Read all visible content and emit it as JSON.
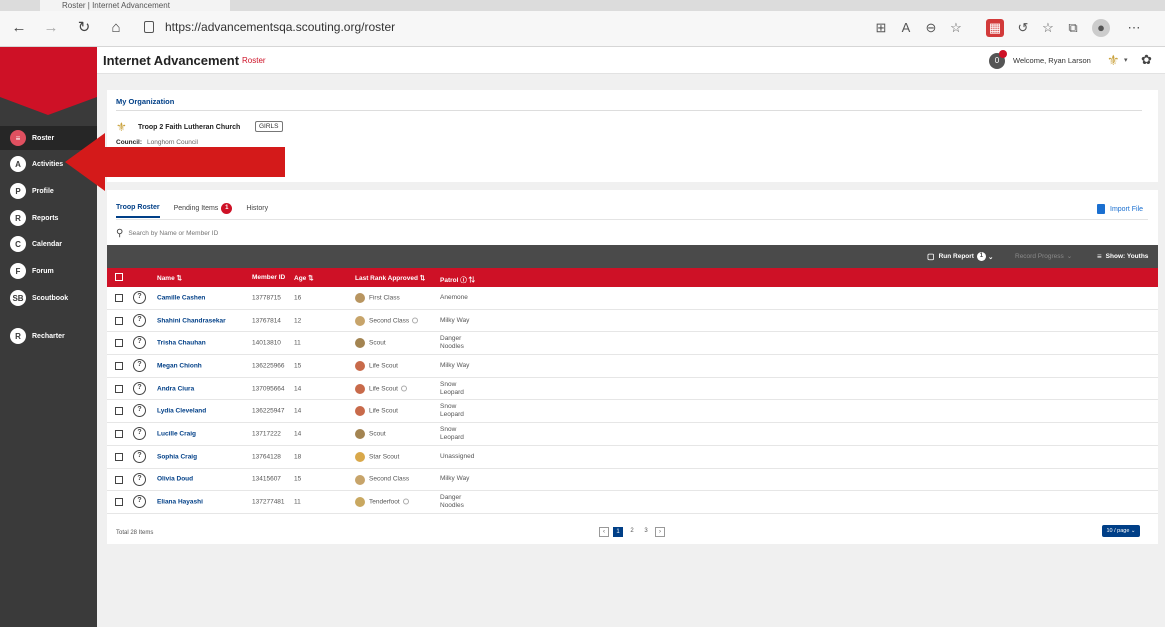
{
  "browser": {
    "tab_title": "Roster | Internet Advancement",
    "url": "https://advancementsqa.scouting.org/roster"
  },
  "sidebar": {
    "items": [
      {
        "label": "Roster",
        "icon": "roster-icon",
        "glyph": "≡",
        "active": true
      },
      {
        "label": "Activities",
        "icon": "activities-icon",
        "glyph": "A"
      },
      {
        "label": "Profile",
        "icon": "profile-icon",
        "glyph": "P"
      },
      {
        "label": "Reports",
        "icon": "reports-icon",
        "glyph": "R"
      },
      {
        "label": "Calendar",
        "icon": "calendar-icon",
        "glyph": "C"
      },
      {
        "label": "Forum",
        "icon": "forum-icon",
        "glyph": "F"
      },
      {
        "label": "Scoutbook",
        "icon": "scoutbook-icon",
        "glyph": "SB"
      },
      {
        "label": "Recharter",
        "icon": "recharter-icon",
        "glyph": "R"
      }
    ]
  },
  "header": {
    "title": "Internet Advancement",
    "subtitle": "Roster",
    "notification_count": "0",
    "welcome": "Welcome, Ryan Larson"
  },
  "organization": {
    "heading": "My Organization",
    "unit_name": "Troop 2 Faith Lutheran Church",
    "unit_tag": "GIRLS",
    "council_label": "Council:",
    "council_value": "Longhorn Council"
  },
  "roster": {
    "tabs": [
      {
        "label": "Troop Roster",
        "active": true
      },
      {
        "label": "Pending Items",
        "count": "1"
      },
      {
        "label": "History"
      }
    ],
    "import_label": "Import File",
    "search_placeholder": "Search by Name or Member ID",
    "actions": {
      "run_report": "Run Report",
      "run_report_badge": "1",
      "record_progress": "Record Progress",
      "show_filter": "Show: Youths"
    },
    "columns": {
      "name": "Name",
      "member_id": "Member ID",
      "age": "Age",
      "last_rank": "Last Rank Approved",
      "patrol": "Patrol"
    },
    "rows": [
      {
        "name": "Camille Cashen",
        "member_id": "13778715",
        "age": "16",
        "rank": "First Class",
        "rank_color": "#b89560",
        "patrol": "Anemone",
        "info": false
      },
      {
        "name": "Shahini Chandrasekar",
        "member_id": "13767814",
        "age": "12",
        "rank": "Second Class",
        "rank_color": "#c7a46a",
        "patrol": "Milky Way",
        "info": true
      },
      {
        "name": "Trisha Chauhan",
        "member_id": "14013810",
        "age": "11",
        "rank": "Scout",
        "rank_color": "#a38451",
        "patrol": "Danger\nNoodles",
        "info": false
      },
      {
        "name": "Megan Chionh",
        "member_id": "136225966",
        "age": "15",
        "rank": "Life Scout",
        "rank_color": "#c86a4a",
        "patrol": "Milky Way",
        "info": false
      },
      {
        "name": "Andra Ciura",
        "member_id": "137095664",
        "age": "14",
        "rank": "Life Scout",
        "rank_color": "#c86a4a",
        "patrol": "Snow\nLeopard",
        "info": true
      },
      {
        "name": "Lydia Cleveland",
        "member_id": "136225947",
        "age": "14",
        "rank": "Life Scout",
        "rank_color": "#c86a4a",
        "patrol": "Snow\nLeopard",
        "info": false
      },
      {
        "name": "Lucille Craig",
        "member_id": "13717222",
        "age": "14",
        "rank": "Scout",
        "rank_color": "#a38451",
        "patrol": "Snow\nLeopard",
        "info": false
      },
      {
        "name": "Sophia Craig",
        "member_id": "13764128",
        "age": "18",
        "rank": "Star Scout",
        "rank_color": "#d9a84a",
        "patrol": "Unassigned",
        "info": false
      },
      {
        "name": "Olivia Doud",
        "member_id": "13415607",
        "age": "15",
        "rank": "Second Class",
        "rank_color": "#c7a46a",
        "patrol": "Milky Way",
        "info": false
      },
      {
        "name": "Eliana Hayashi",
        "member_id": "137277481",
        "age": "11",
        "rank": "Tenderfoot",
        "rank_color": "#c9a860",
        "patrol": "Danger\nNoodles",
        "info": true
      }
    ],
    "total": "Total 28 Items",
    "pages": [
      "1",
      "2",
      "3"
    ],
    "per_page": "10 / page"
  },
  "colors": {
    "brand_red": "#ce1126",
    "brand_blue": "#003f87",
    "sidebar_bg": "#3a3a3a"
  }
}
